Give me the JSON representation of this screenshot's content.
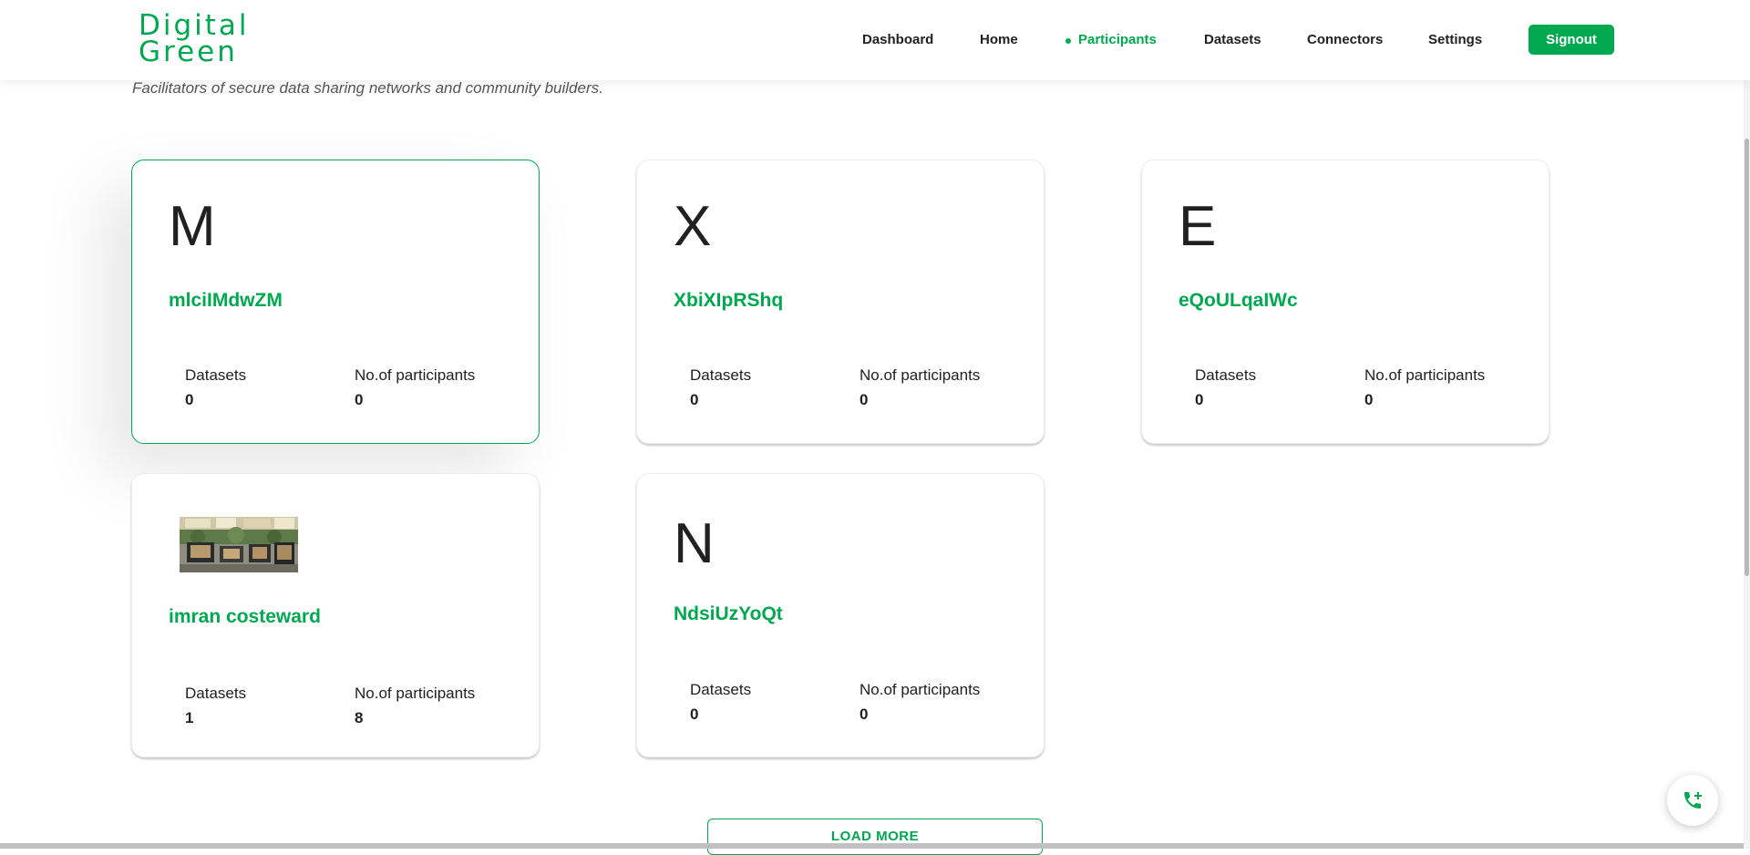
{
  "brand": {
    "logo_line1": "Digital",
    "logo_line2": "Green",
    "accent_color": "#00a94f"
  },
  "nav": {
    "items": [
      {
        "label": "Dashboard",
        "active": false
      },
      {
        "label": "Home",
        "active": false
      },
      {
        "label": "Participants",
        "active": true
      },
      {
        "label": "Datasets",
        "active": false
      },
      {
        "label": "Connectors",
        "active": false
      },
      {
        "label": "Settings",
        "active": false
      }
    ],
    "signout_label": "Signout"
  },
  "tagline": "Facilitators of secure data sharing networks and community builders.",
  "cards": [
    {
      "letter": "M",
      "name": "mlciIMdwZM",
      "datasets_label": "Datasets",
      "datasets": "0",
      "participants_label": "No.of participants",
      "participants": "0",
      "selected": true
    },
    {
      "letter": "X",
      "name": "XbiXIpRShq",
      "datasets_label": "Datasets",
      "datasets": "0",
      "participants_label": "No.of participants",
      "participants": "0"
    },
    {
      "letter": "E",
      "name": "eQoULqaIWc",
      "datasets_label": "Datasets",
      "datasets": "0",
      "participants_label": "No.of participants",
      "participants": "0"
    },
    {
      "letter": "",
      "image": "organisation-logo-photo",
      "name": "imran costeward",
      "datasets_label": "Datasets",
      "datasets": "1",
      "participants_label": "No.of participants",
      "participants": "8"
    },
    {
      "letter": "N",
      "name": "NdsiUzYoQt",
      "datasets_label": "Datasets",
      "datasets": "0",
      "participants_label": "No.of participants",
      "participants": "0"
    }
  ],
  "load_more_label": "LOAD MORE",
  "fab": {
    "icon": "phone-add-icon"
  }
}
